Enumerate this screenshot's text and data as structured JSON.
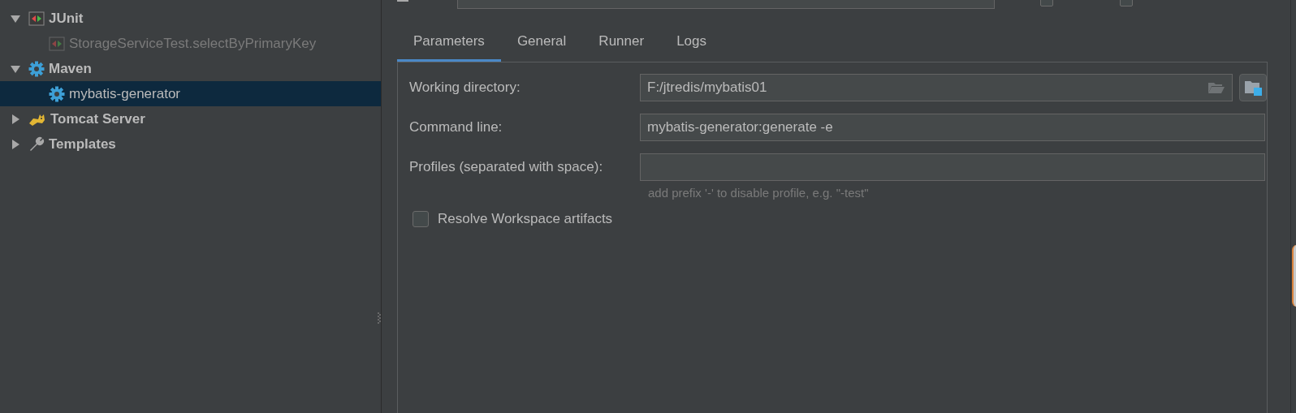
{
  "top_bar": {
    "checkboxes": [
      {
        "checked": false
      },
      {
        "checked": false
      }
    ]
  },
  "sidebar": {
    "items": [
      {
        "label": "JUnit",
        "kind": "junit",
        "expanded": true,
        "selected": false,
        "disabled": false,
        "children": [
          {
            "label": "StorageServiceTest.selectByPrimaryKey",
            "kind": "junit",
            "selected": false,
            "disabled": true
          }
        ]
      },
      {
        "label": "Maven",
        "kind": "maven",
        "expanded": true,
        "selected": false,
        "disabled": false,
        "children": [
          {
            "label": "mybatis-generator",
            "kind": "maven",
            "selected": true,
            "disabled": false
          }
        ]
      },
      {
        "label": "Tomcat Server",
        "kind": "tomcat",
        "expanded": false,
        "selected": false,
        "disabled": false
      },
      {
        "label": "Templates",
        "kind": "templates",
        "expanded": false,
        "selected": false,
        "disabled": false
      }
    ]
  },
  "tabs": [
    {
      "label": "Parameters",
      "selected": true
    },
    {
      "label": "General",
      "selected": false
    },
    {
      "label": "Runner",
      "selected": false
    },
    {
      "label": "Logs",
      "selected": false
    }
  ],
  "form": {
    "working_directory": {
      "label": "Working directory:",
      "value": "F:/jtredis/mybatis01"
    },
    "command_line": {
      "label": "Command line:",
      "value": "mybatis-generator:generate -e"
    },
    "profiles": {
      "label": "Profiles (separated with space):",
      "hint": "add prefix '-' to disable profile, e.g. \"-test\""
    },
    "resolve_workspace": {
      "label": "Resolve Workspace artifacts",
      "checked": false
    }
  }
}
